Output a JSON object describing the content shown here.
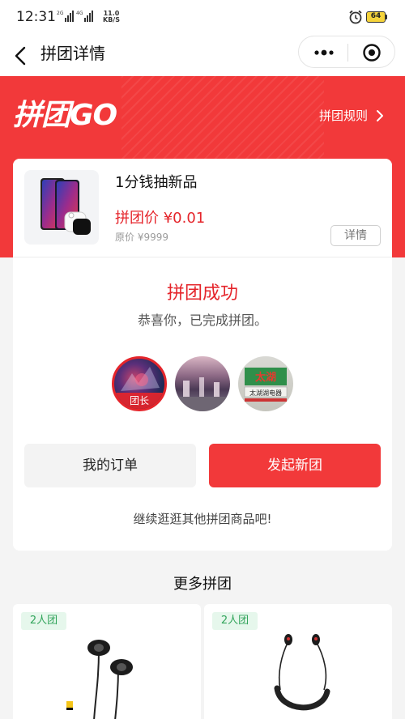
{
  "status_bar": {
    "time": "12:31",
    "signal_1_label": "2G",
    "signal_2_label": "4G",
    "speed_value": "11.0",
    "speed_unit": "KB/S",
    "battery": "64"
  },
  "nav": {
    "title": "拼团详情",
    "icons": [
      "back-icon",
      "more-dots-icon",
      "close-circle-icon"
    ]
  },
  "banner": {
    "logo": "拼团GO",
    "rules_label": "拼团规则"
  },
  "product": {
    "name": "1分钱抽新品",
    "group_price": "拼团价 ¥0.01",
    "original_price": "原价 ¥9999",
    "detail_button": "详情"
  },
  "result": {
    "title": "拼团成功",
    "subtitle": "恭喜你，已完成拼团。",
    "leader_tag": "团长",
    "avatar_3_sign": "太湖湖电器"
  },
  "actions": {
    "my_orders": "我的订单",
    "start_new": "发起新团"
  },
  "browse_more": "继续逛逛其他拼团商品吧!",
  "more_groups": {
    "title": "更多拼团",
    "items": [
      {
        "badge": "2人团"
      },
      {
        "badge": "2人团"
      }
    ]
  },
  "colors": {
    "brand_red": "#f2393a",
    "price_red": "#e5252b",
    "badge_green": "#32a45b"
  }
}
